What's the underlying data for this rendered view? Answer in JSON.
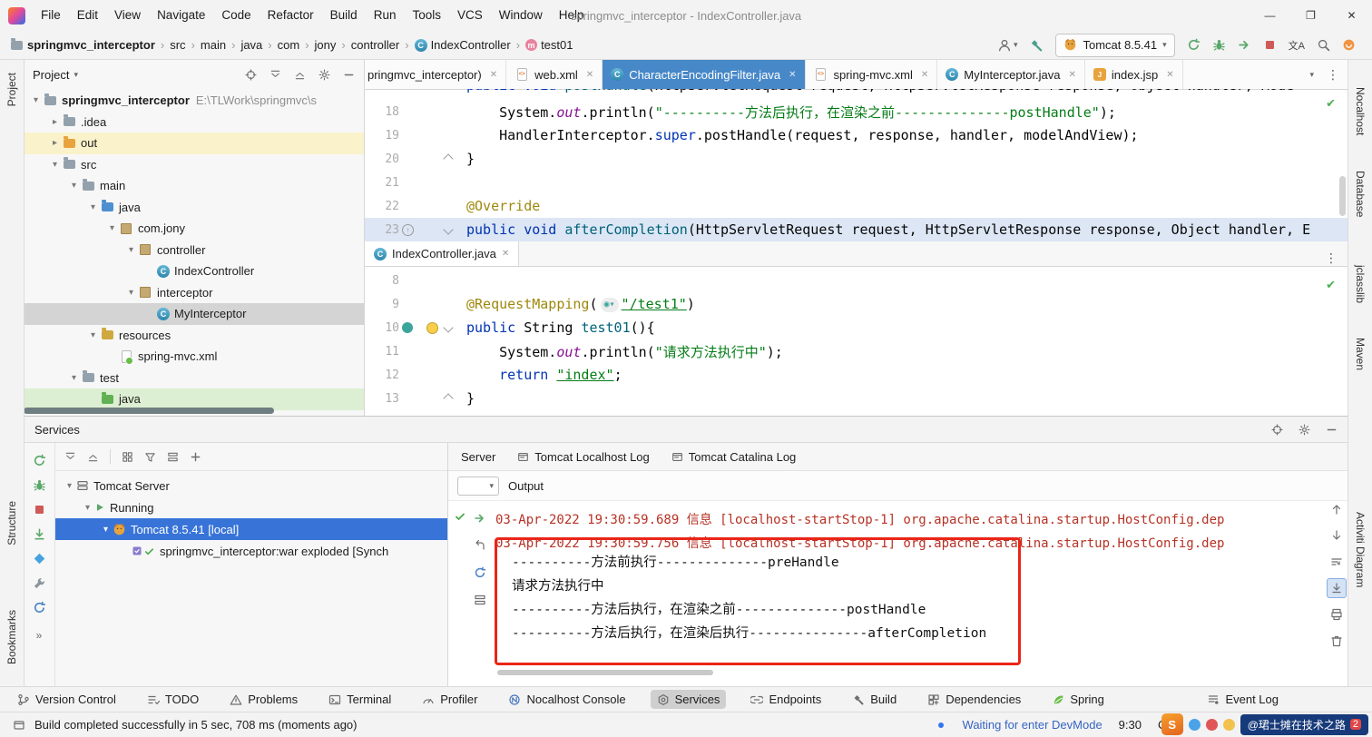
{
  "window": {
    "title": "springmvc_interceptor - IndexController.java",
    "menu": [
      "File",
      "Edit",
      "View",
      "Navigate",
      "Code",
      "Refactor",
      "Build",
      "Run",
      "Tools",
      "VCS",
      "Window",
      "Help"
    ],
    "controls": {
      "minimize": "—",
      "maximize": "❐",
      "close": "✕"
    }
  },
  "toolbar": {
    "breadcrumbs": [
      {
        "label": "springmvc_interceptor",
        "icon": "folder",
        "bold": true
      },
      {
        "label": "src"
      },
      {
        "label": "main"
      },
      {
        "label": "java"
      },
      {
        "label": "com"
      },
      {
        "label": "jony"
      },
      {
        "label": "controller"
      },
      {
        "label": "IndexController",
        "icon": "class"
      },
      {
        "label": "test01",
        "icon": "method"
      }
    ],
    "run_config": "Tomcat 8.5.41"
  },
  "left_stripe": {
    "project": "Project",
    "structure": "Structure",
    "bookmarks": "Bookmarks"
  },
  "right_stripe": {
    "labels": [
      "Nocalhost",
      "Database",
      "jclasslib",
      "Maven",
      "Activiti Diagram"
    ]
  },
  "project": {
    "title": "Project",
    "items": [
      {
        "level": 0,
        "arrow": "down",
        "icon": "folder",
        "label": "springmvc_interceptor",
        "path": "E:\\TLWork\\springmvc\\s",
        "bold": true
      },
      {
        "level": 1,
        "arrow": "right",
        "icon": "folder",
        "label": ".idea"
      },
      {
        "level": 1,
        "arrow": "right",
        "icon": "folder-excluded",
        "label": "out",
        "hl": "row-yellow"
      },
      {
        "level": 1,
        "arrow": "down",
        "icon": "folder",
        "label": "src"
      },
      {
        "level": 2,
        "arrow": "down",
        "icon": "folder",
        "label": "main"
      },
      {
        "level": 3,
        "arrow": "down",
        "icon": "folder-source",
        "label": "java"
      },
      {
        "level": 4,
        "arrow": "down",
        "icon": "package",
        "label": "com.jony"
      },
      {
        "level": 5,
        "arrow": "down",
        "icon": "package",
        "label": "controller"
      },
      {
        "level": 6,
        "arrow": "none",
        "icon": "class",
        "label": "IndexController"
      },
      {
        "level": 5,
        "arrow": "down",
        "icon": "package",
        "label": "interceptor"
      },
      {
        "level": 6,
        "arrow": "none",
        "icon": "class",
        "label": "MyInterceptor",
        "hl": "row-selected"
      },
      {
        "level": 3,
        "arrow": "down",
        "icon": "folder-resources",
        "label": "resources"
      },
      {
        "level": 4,
        "arrow": "none",
        "icon": "xml-spring",
        "label": "spring-mvc.xml"
      },
      {
        "level": 2,
        "arrow": "down",
        "icon": "folder",
        "label": "test"
      },
      {
        "level": 3,
        "arrow": "none",
        "icon": "folder-test",
        "label": "java",
        "hl": "row-green"
      }
    ]
  },
  "editor_tabs": [
    {
      "label": "pringmvc_interceptor)",
      "icon": "none"
    },
    {
      "label": "web.xml",
      "icon": "xml"
    },
    {
      "label": "CharacterEncodingFilter.java",
      "icon": "class",
      "active": true
    },
    {
      "label": "spring-mvc.xml",
      "icon": "xml"
    },
    {
      "label": "MyInterceptor.java",
      "icon": "class"
    },
    {
      "label": "index.jsp",
      "icon": "jsp"
    }
  ],
  "editor_top": {
    "partial": [
      {
        "c": "kw",
        "t": "public void "
      },
      {
        "c": "mth",
        "t": "postHandle"
      },
      {
        "c": "pln",
        "t": "(HttpServletRequest request, HttpServletResponse response, Object handler, Mode"
      }
    ],
    "lines": [
      {
        "no": "18",
        "segments": [
          {
            "c": "pln",
            "t": "    System."
          },
          {
            "c": "fld",
            "t": "out"
          },
          {
            "c": "pln",
            "t": ".println("
          },
          {
            "c": "str",
            "t": "\"----------方法后执行，在渲染之前--------------postHandle\""
          },
          {
            "c": "pln",
            "t": ");"
          }
        ]
      },
      {
        "no": "19",
        "segments": [
          {
            "c": "pln",
            "t": "    HandlerInterceptor."
          },
          {
            "c": "kw",
            "t": "super"
          },
          {
            "c": "pln",
            "t": ".postHandle(request, response, handler, modelAndView);"
          }
        ]
      },
      {
        "no": "20",
        "fold": "up",
        "segments": [
          {
            "c": "pln",
            "t": "}"
          }
        ]
      },
      {
        "no": "21",
        "segments": []
      },
      {
        "no": "22",
        "segments": [
          {
            "c": "ann",
            "t": "@Override"
          }
        ]
      },
      {
        "no": "23",
        "cl": true,
        "gutter": "override",
        "fold": "down",
        "segments": [
          {
            "c": "kw",
            "t": "public void "
          },
          {
            "c": "mth",
            "t": "afterCompletion"
          },
          {
            "c": "pln",
            "t": "(HttpServletRequest request, HttpServletResponse response, Object handler, E"
          }
        ]
      }
    ]
  },
  "split_tab": {
    "label": "IndexController.java"
  },
  "editor_bottom": {
    "lines": [
      {
        "no": "8",
        "segments": []
      },
      {
        "no": "9",
        "segments": [
          {
            "c": "ann",
            "t": "@RequestMapping"
          },
          {
            "c": "pln",
            "t": "("
          },
          {
            "c": "inlay",
            "t": "◉▾"
          },
          {
            "c": "stru",
            "t": "\"/test1\""
          },
          {
            "c": "pln",
            "t": ")"
          }
        ]
      },
      {
        "no": "10",
        "gutter": "mapping",
        "bulb": true,
        "fold": "down",
        "segments": [
          {
            "c": "kw",
            "t": "public "
          },
          {
            "c": "pln",
            "t": "String "
          },
          {
            "c": "mth",
            "t": "test01"
          },
          {
            "c": "pln",
            "t": "(){"
          }
        ]
      },
      {
        "no": "11",
        "segments": [
          {
            "c": "pln",
            "t": "    System."
          },
          {
            "c": "fld",
            "t": "out"
          },
          {
            "c": "pln",
            "t": ".println("
          },
          {
            "c": "str",
            "t": "\"请求方法执行中\""
          },
          {
            "c": "pln",
            "t": ");"
          }
        ]
      },
      {
        "no": "12",
        "segments": [
          {
            "c": "pln",
            "t": "    "
          },
          {
            "c": "kw",
            "t": "return "
          },
          {
            "c": "stru",
            "t": "\"index\""
          },
          {
            "c": "pln",
            "t": ";"
          }
        ]
      },
      {
        "no": "13",
        "fold": "up",
        "segments": [
          {
            "c": "pln",
            "t": "}"
          }
        ]
      }
    ]
  },
  "services": {
    "title": "Services",
    "tree": [
      {
        "level": 0,
        "arrow": "down",
        "icon": "server",
        "label": "Tomcat Server"
      },
      {
        "level": 1,
        "arrow": "down",
        "icon": "run",
        "label": "Running"
      },
      {
        "level": 2,
        "arrow": "down",
        "icon": "tomcat",
        "label": "Tomcat 8.5.41 [local]",
        "selected": true
      },
      {
        "level": 3,
        "arrow": "none",
        "icon": "artifact",
        "label": "springmvc_interceptor:war exploded [Synch"
      }
    ],
    "tabs": [
      {
        "label": "Server"
      },
      {
        "label": "Tomcat Localhost Log",
        "icon": "console"
      },
      {
        "label": "Tomcat Catalina Log",
        "icon": "console"
      }
    ],
    "output_label": "Output",
    "log_lines": [
      "03-Apr-2022 19:30:59.689 信息 [localhost-startStop-1] org.apache.catalina.startup.HostConfig.dep",
      "03-Apr-2022 19:30:59.756 信息 [localhost-startStop-1] org.apache.catalina.startup.HostConfig.dep"
    ],
    "boxed_lines": [
      "----------方法前执行--------------preHandle",
      "请求方法执行中",
      "----------方法后执行，在渲染之前--------------postHandle",
      "----------方法后执行，在渲染后执行---------------afterCompletion"
    ]
  },
  "bottom_bar": {
    "items": [
      {
        "label": "Version Control",
        "icon": "branch"
      },
      {
        "label": "TODO",
        "icon": "todo"
      },
      {
        "label": "Problems",
        "icon": "problems"
      },
      {
        "label": "Terminal",
        "icon": "terminal"
      },
      {
        "label": "Profiler",
        "icon": "profiler"
      },
      {
        "label": "Nocalhost Console",
        "icon": "nocalhost"
      },
      {
        "label": "Services",
        "icon": "services",
        "active": true
      },
      {
        "label": "Endpoints",
        "icon": "endpoints"
      },
      {
        "label": "Build",
        "icon": "build"
      },
      {
        "label": "Dependencies",
        "icon": "deps"
      },
      {
        "label": "Spring",
        "icon": "spring"
      }
    ],
    "right_items": [
      {
        "label": "Event Log",
        "icon": "eventlog"
      }
    ]
  },
  "status_bar": {
    "message": "Build completed successfully in 5 sec, 708 ms (moments ago)",
    "devmode": "Waiting for enter DevMode",
    "time": "9:30",
    "right_text": "CRL"
  },
  "watermark": {
    "text": "@珺士摊在技术之路",
    "badge": "2"
  }
}
